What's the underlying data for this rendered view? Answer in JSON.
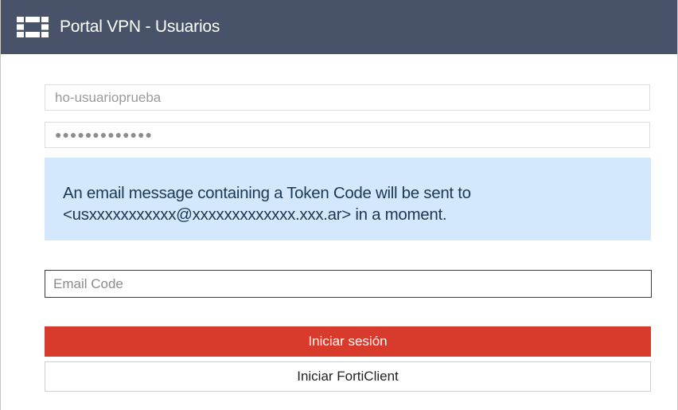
{
  "header": {
    "title": "Portal VPN - Usuarios",
    "logo_icon": "fortinet-logo-icon"
  },
  "form": {
    "username_value": "ho-usuarioprueba",
    "password_masked": "●●●●●●●●●●●●●",
    "info_message_line1": "An email message containing a Token Code will be sent to",
    "info_message_line2": "<usxxxxxxxxxxx@xxxxxxxxxxxxx.xxx.ar> in a moment.",
    "email_code_placeholder": "Email Code",
    "email_code_value": ""
  },
  "buttons": {
    "login_label": "Iniciar sesión",
    "forticlient_label": "Iniciar FortiClient"
  },
  "colors": {
    "header_bg": "#48536a",
    "info_bg": "#d3e8fc",
    "login_button": "#d83a2b"
  }
}
